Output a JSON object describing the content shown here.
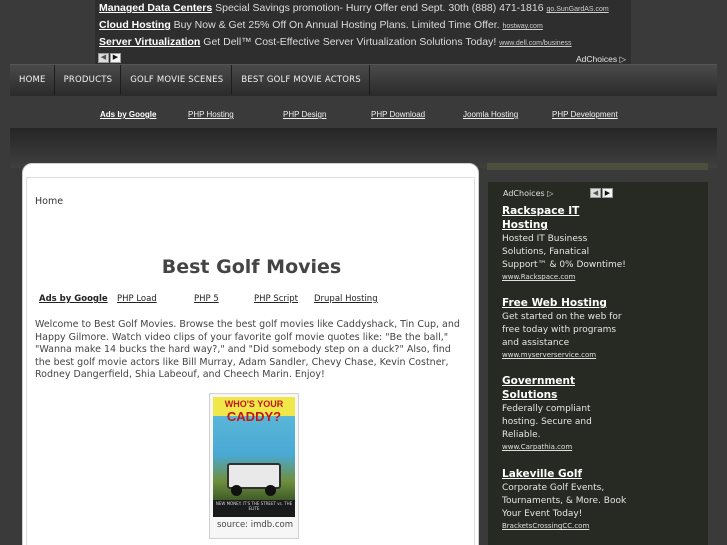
{
  "top_ad": {
    "items": [
      {
        "title": "Managed Data Centers",
        "text": "Special Savings promotion- Hurry Offer end Sept. 30th (888) 471-1816",
        "url": "go.SunGardAS.com"
      },
      {
        "title": "Cloud Hosting",
        "text": "Buy Now & Get 25% Off On Annual Hosting Plans. Limited Time Offer.",
        "url": "hostway.com"
      },
      {
        "title": "Server Virtualization",
        "text": "Get Dell™ Cost-Effective Server Virtualization Solutions Today!",
        "url": "www.dell.com/business"
      }
    ],
    "prev": "◀",
    "next": "▶",
    "adchoices": "AdChoices ▷"
  },
  "nav": {
    "items": [
      "HOME",
      "PRODUCTS",
      "GOLF MOVIE SCENES",
      "BEST GOLF MOVIE ACTORS"
    ]
  },
  "ad_links": {
    "label": "Ads by Google",
    "links": [
      "PHP Hosting",
      "PHP Design",
      "PHP Download",
      "Joomla Hosting",
      "PHP Development"
    ]
  },
  "content": {
    "breadcrumb": "Home",
    "title": "Best Golf Movies",
    "ads_label": "Ads by Google",
    "ad_links": [
      "PHP Load",
      "PHP 5",
      "PHP Script",
      "Drupal Hosting"
    ],
    "intro": "Welcome to Best Golf Movies. Browse the best golf movies like Caddyshack, Tin Cup, and Happy Gilmore. Watch video clips of your favorite golf movie quotes like: \"Be the ball,\" \"Wanna make 14 bucks the hard way?,\" and \"Did somebody step on a duck?\" Also, find the best golf movie actors like Bill Murray, Adam Sandler, Chevy Chase, Kevin Costner, Rodney Dangerfield, Shia Labeouf, and Cheech Marin. Enjoy!",
    "poster": {
      "title_line1": "WHO'S YOUR",
      "title_line2": "CADDY?",
      "tagline": "NEW MONEY. IT'S THE STREET vs. THE ELITE",
      "caption": "source: imdb.com"
    }
  },
  "sidebar": {
    "adchoices": "AdChoices ▷",
    "prev": "◀",
    "next": "▶",
    "ads": [
      {
        "title": "Rackspace IT Hosting",
        "desc": "Hosted IT Business Solutions, Fanatical Support™ & 0% Downtime!",
        "url": "www.Rackspace.com"
      },
      {
        "title": "Free Web Hosting",
        "desc": "Get started on the web for free today with programs and assistance",
        "url": "www.myserverservice.com"
      },
      {
        "title": "Government Solutions",
        "desc": "Federally compliant hosting. Secure and Reliable.",
        "url": "www.Carpathia.com"
      },
      {
        "title": "Lakeville Golf",
        "desc": "Corporate Golf Events, Tournaments, & More. Book Your Event Today!",
        "url": "BracketsCrossingCC.com"
      }
    ]
  },
  "colors": {
    "page_bg": "#3a3a3a",
    "sidebar_bg": "#262a22",
    "title_text": "#444444"
  }
}
